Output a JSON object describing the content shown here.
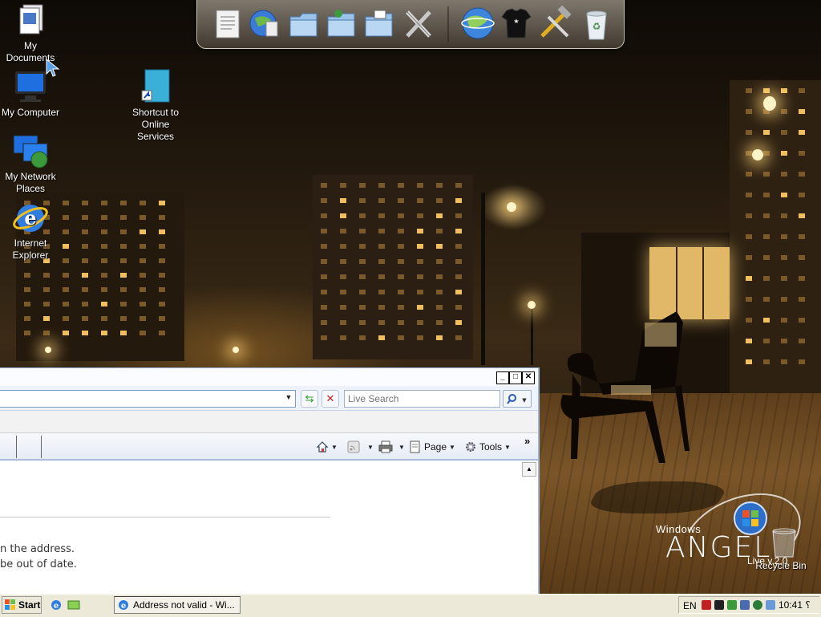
{
  "desktop": {
    "icons": [
      {
        "label": "My Documents"
      },
      {
        "label": "My Computer"
      },
      {
        "label": "My Network Places"
      },
      {
        "label": "Internet Explorer"
      },
      {
        "label": "Shortcut to Online Services"
      }
    ]
  },
  "dock": {
    "items": [
      "document-icon",
      "globe-document-icon",
      "folder-icon",
      "music-folder-icon",
      "pictures-folder-icon",
      "tools-icon",
      "internet-globe-icon",
      "tshirt-icon",
      "hammer-wrench-icon",
      "recycle-bin-icon"
    ]
  },
  "ie": {
    "search_placeholder": "Live Search",
    "commands": {
      "page": "Page",
      "tools": "Tools"
    },
    "message_line1": "n the address.",
    "message_line2": "be out of date.",
    "chevron": "»"
  },
  "brand": {
    "windows": "Windows",
    "angel": "ANGEL",
    "version": "Live v.2.0",
    "recycle_bin": "Recycle Bin"
  },
  "taskbar": {
    "start_label": "Start",
    "task_label": "Address not valid - Wi...",
    "language": "EN",
    "clock": "10:41 ؟"
  }
}
